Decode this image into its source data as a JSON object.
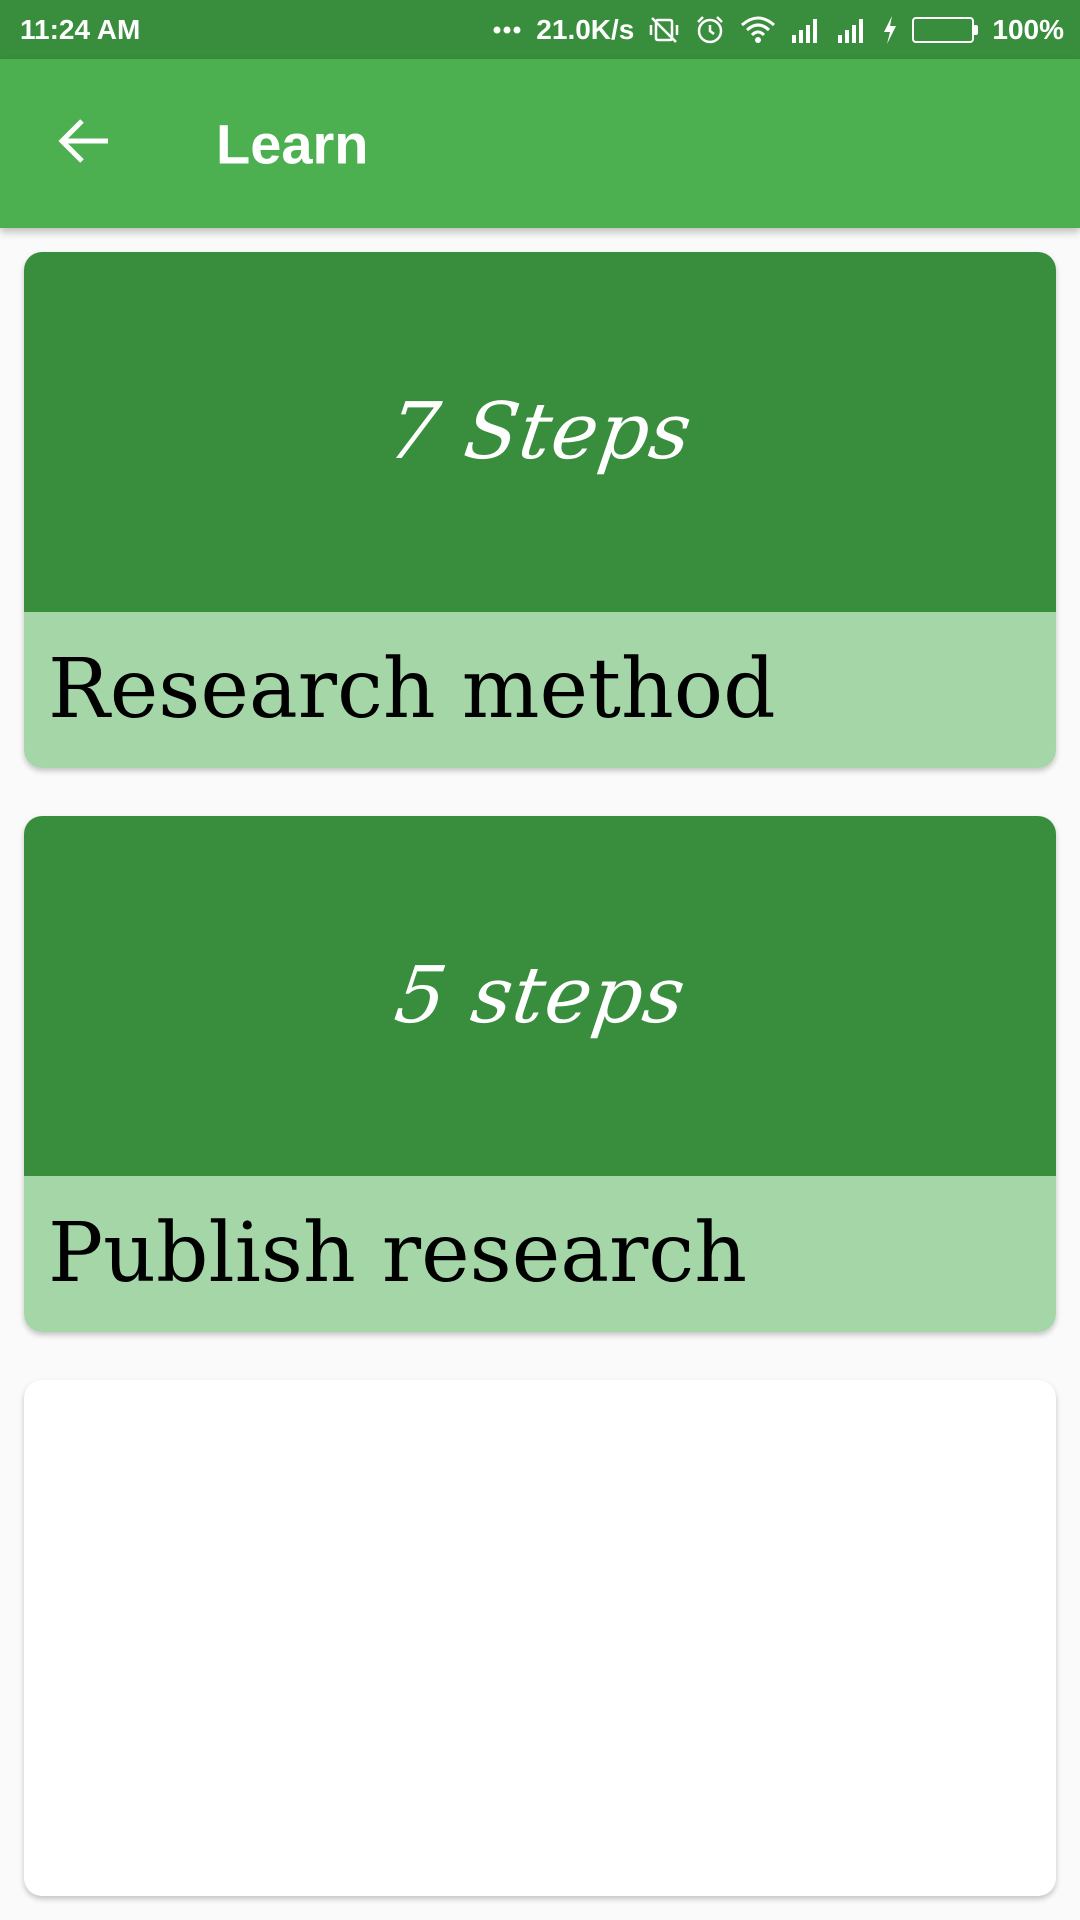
{
  "status_bar": {
    "time": "11:24 AM",
    "network_speed": "21.0K/s",
    "battery_percent": "100%",
    "battery_level": 1.0,
    "icons": [
      "more-dots-icon",
      "vibrate-off-icon",
      "alarm-icon",
      "wifi-icon",
      "signal-icon",
      "signal-icon",
      "charging-icon",
      "battery-icon"
    ]
  },
  "app_bar": {
    "title": "Learn",
    "back_icon": "arrow-back-icon"
  },
  "colors": {
    "status_bar": "#388e3c",
    "app_bar": "#4caf50",
    "card_banner": "#388e3c",
    "card_footer": "#a5d6a7",
    "background": "#fafafa"
  },
  "cards": [
    {
      "steps": "7 Steps",
      "title": "Research method"
    },
    {
      "steps": "5 steps",
      "title": "Publish research"
    },
    {
      "steps": "",
      "title": ""
    }
  ]
}
